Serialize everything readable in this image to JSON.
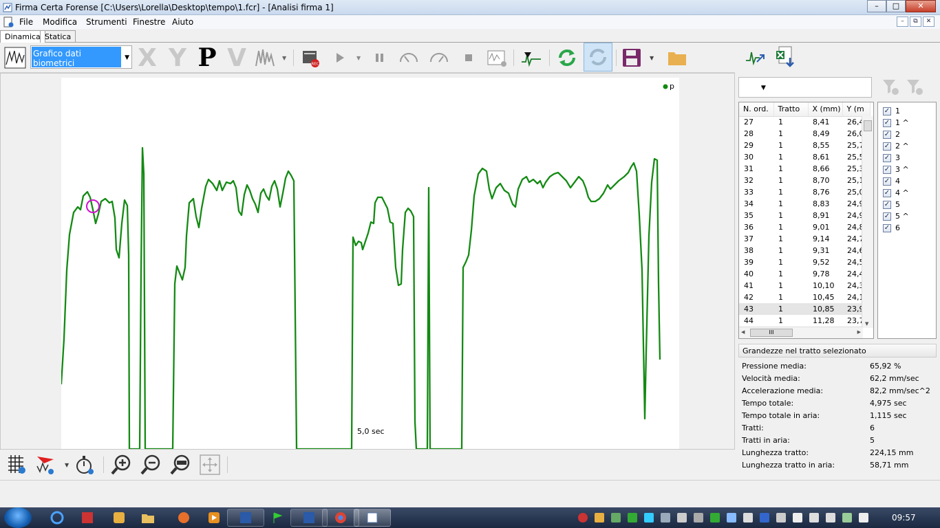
{
  "window": {
    "title": "Firma Certa Forense [C:\\Users\\Lorella\\Desktop\\tempo\\1.fcr] - [Analisi firma 1]",
    "buttons": {
      "minimize": "–",
      "maximize": "□",
      "close": "✕"
    }
  },
  "menu": {
    "items": [
      "File",
      "Modifica",
      "Strumenti",
      "Finestre",
      "Aiuto"
    ]
  },
  "mdi": {
    "minimize": "–",
    "restore": "⧉",
    "close": "✕"
  },
  "tabs": [
    "Dinamica",
    "Statica"
  ],
  "toolbar": {
    "view_select": "Grafico dati biometrici",
    "letters": {
      "x": "X",
      "y": "Y",
      "p": "P",
      "v": "V"
    },
    "record_badge": "REC"
  },
  "chart": {
    "legend": "p",
    "time_label": "5,0 sec",
    "color": "#138a13",
    "cursor_color": "#d010d0"
  },
  "right_panel": {
    "filter_select": "-",
    "grid": {
      "columns": [
        "N. ord.",
        "Tratto",
        "X (mm)",
        "Y (m"
      ],
      "rows": [
        [
          "27",
          "1",
          "8,41",
          "26,4"
        ],
        [
          "28",
          "1",
          "8,49",
          "26,0"
        ],
        [
          "29",
          "1",
          "8,55",
          "25,7"
        ],
        [
          "30",
          "1",
          "8,61",
          "25,5"
        ],
        [
          "31",
          "1",
          "8,66",
          "25,3"
        ],
        [
          "32",
          "1",
          "8,70",
          "25,1"
        ],
        [
          "33",
          "1",
          "8,76",
          "25,0"
        ],
        [
          "34",
          "1",
          "8,83",
          "24,9"
        ],
        [
          "35",
          "1",
          "8,91",
          "24,9"
        ],
        [
          "36",
          "1",
          "9,01",
          "24,8"
        ],
        [
          "37",
          "1",
          "9,14",
          "24,7"
        ],
        [
          "38",
          "1",
          "9,31",
          "24,6"
        ],
        [
          "39",
          "1",
          "9,52",
          "24,5"
        ],
        [
          "40",
          "1",
          "9,78",
          "24,4"
        ],
        [
          "41",
          "1",
          "10,10",
          "24,3"
        ],
        [
          "42",
          "1",
          "10,45",
          "24,1"
        ],
        [
          "43",
          "1",
          "10,85",
          "23,9"
        ],
        [
          "44",
          "1",
          "11,28",
          "23,7"
        ]
      ],
      "selected_row": "43",
      "hscroll_grip": "III"
    },
    "strokes": [
      "1",
      "1 ^",
      "2",
      "2 ^",
      "3",
      "3 ^",
      "4",
      "4 ^",
      "5",
      "5 ^",
      "6"
    ],
    "checkmark": "✓",
    "section_title": "Grandezze nel tratto selezionato",
    "stats": [
      {
        "label": "Pressione media:",
        "value": "65,92 %"
      },
      {
        "label": "Velocità media:",
        "value": "62,2 mm/sec"
      },
      {
        "label": "Accelerazione media:",
        "value": "82,2 mm/sec^2"
      },
      {
        "label": "Tempo totale:",
        "value": "4,975 sec"
      },
      {
        "label": "Tempo totale in aria:",
        "value": "1,115 sec"
      },
      {
        "label": "Tratti:",
        "value": "6"
      },
      {
        "label": "Tratti in aria:",
        "value": "5"
      },
      {
        "label": "Lunghezza tratto:",
        "value": "224,15 mm"
      },
      {
        "label": "Lunghezza tratto in aria:",
        "value": "58,71 mm"
      }
    ]
  },
  "taskbar": {
    "clock": "09:57"
  }
}
